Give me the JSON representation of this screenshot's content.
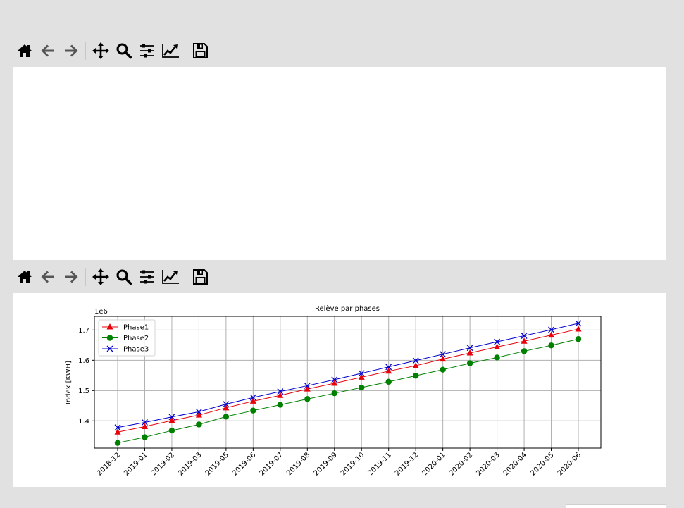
{
  "window": {
    "background": "#e1e1e1"
  },
  "toolbar": {
    "items": [
      {
        "icon": "home-icon",
        "name": "home-button",
        "disabled": false
      },
      {
        "icon": "back-arrow-icon",
        "name": "back-button",
        "disabled": true
      },
      {
        "icon": "forward-arrow-icon",
        "name": "forward-button",
        "disabled": true
      },
      {
        "icon": "pan-icon",
        "name": "pan-button",
        "disabled": false
      },
      {
        "icon": "zoom-icon",
        "name": "zoom-button",
        "disabled": false
      },
      {
        "icon": "subplots-icon",
        "name": "configure-subplots-button",
        "disabled": false
      },
      {
        "icon": "axes-edit-icon",
        "name": "edit-axes-button",
        "disabled": false
      },
      {
        "icon": "save-icon",
        "name": "save-figure-button",
        "disabled": false
      }
    ]
  },
  "chart_data": {
    "type": "line",
    "title": "Relève par phases",
    "xlabel": "",
    "ylabel": "Index  [KWH]",
    "y_offset_label": "1e6",
    "categories": [
      "2018-12",
      "2019-01",
      "2019-02",
      "2019-03",
      "2019-05",
      "2019-06",
      "2019-07",
      "2019-08",
      "2019-09",
      "2019-10",
      "2019-11",
      "2019-12",
      "2020-01",
      "2020-02",
      "2020-03",
      "2020-04",
      "2020-05",
      "2020-06"
    ],
    "ylim": [
      1.31,
      1.745
    ],
    "yticks": [
      1.4,
      1.5,
      1.6,
      1.7
    ],
    "grid": true,
    "legend_position": "top-left",
    "series": [
      {
        "name": "Phase1",
        "color": "#e8000b",
        "marker": "triangle",
        "values": [
          1.363,
          1.381,
          1.401,
          1.419,
          1.443,
          1.465,
          1.484,
          1.505,
          1.524,
          1.544,
          1.564,
          1.582,
          1.604,
          1.624,
          1.644,
          1.663,
          1.683,
          1.703
        ]
      },
      {
        "name": "Phase2",
        "color": "#008000",
        "marker": "circle",
        "values": [
          1.327,
          1.346,
          1.368,
          1.388,
          1.414,
          1.434,
          1.453,
          1.472,
          1.491,
          1.51,
          1.529,
          1.549,
          1.569,
          1.59,
          1.609,
          1.63,
          1.649,
          1.67
        ]
      },
      {
        "name": "Phase3",
        "color": "#0000cc",
        "marker": "x",
        "values": [
          1.378,
          1.395,
          1.413,
          1.43,
          1.455,
          1.477,
          1.497,
          1.516,
          1.536,
          1.557,
          1.578,
          1.599,
          1.62,
          1.641,
          1.661,
          1.681,
          1.701,
          1.722
        ]
      }
    ]
  }
}
